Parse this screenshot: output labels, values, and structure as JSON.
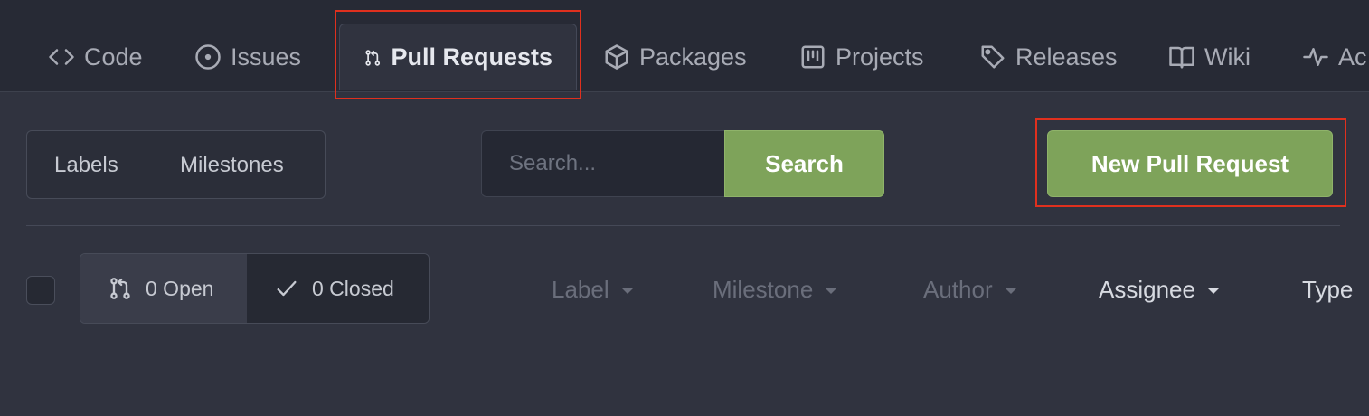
{
  "tabs": {
    "code": "Code",
    "issues": "Issues",
    "pull_requests": "Pull Requests",
    "packages": "Packages",
    "projects": "Projects",
    "releases": "Releases",
    "wiki": "Wiki",
    "activity": "Ac"
  },
  "menu": {
    "labels": "Labels",
    "milestones": "Milestones"
  },
  "search": {
    "placeholder": "Search...",
    "button": "Search"
  },
  "new_pull_request": "New Pull Request",
  "states": {
    "open": "0 Open",
    "closed": "0 Closed"
  },
  "filters": {
    "label": "Label",
    "milestone": "Milestone",
    "author": "Author",
    "assignee": "Assignee",
    "type": "Type"
  },
  "colors": {
    "accent_green": "#7ea35a",
    "highlight": "#e0301e",
    "background": "#30333f"
  }
}
